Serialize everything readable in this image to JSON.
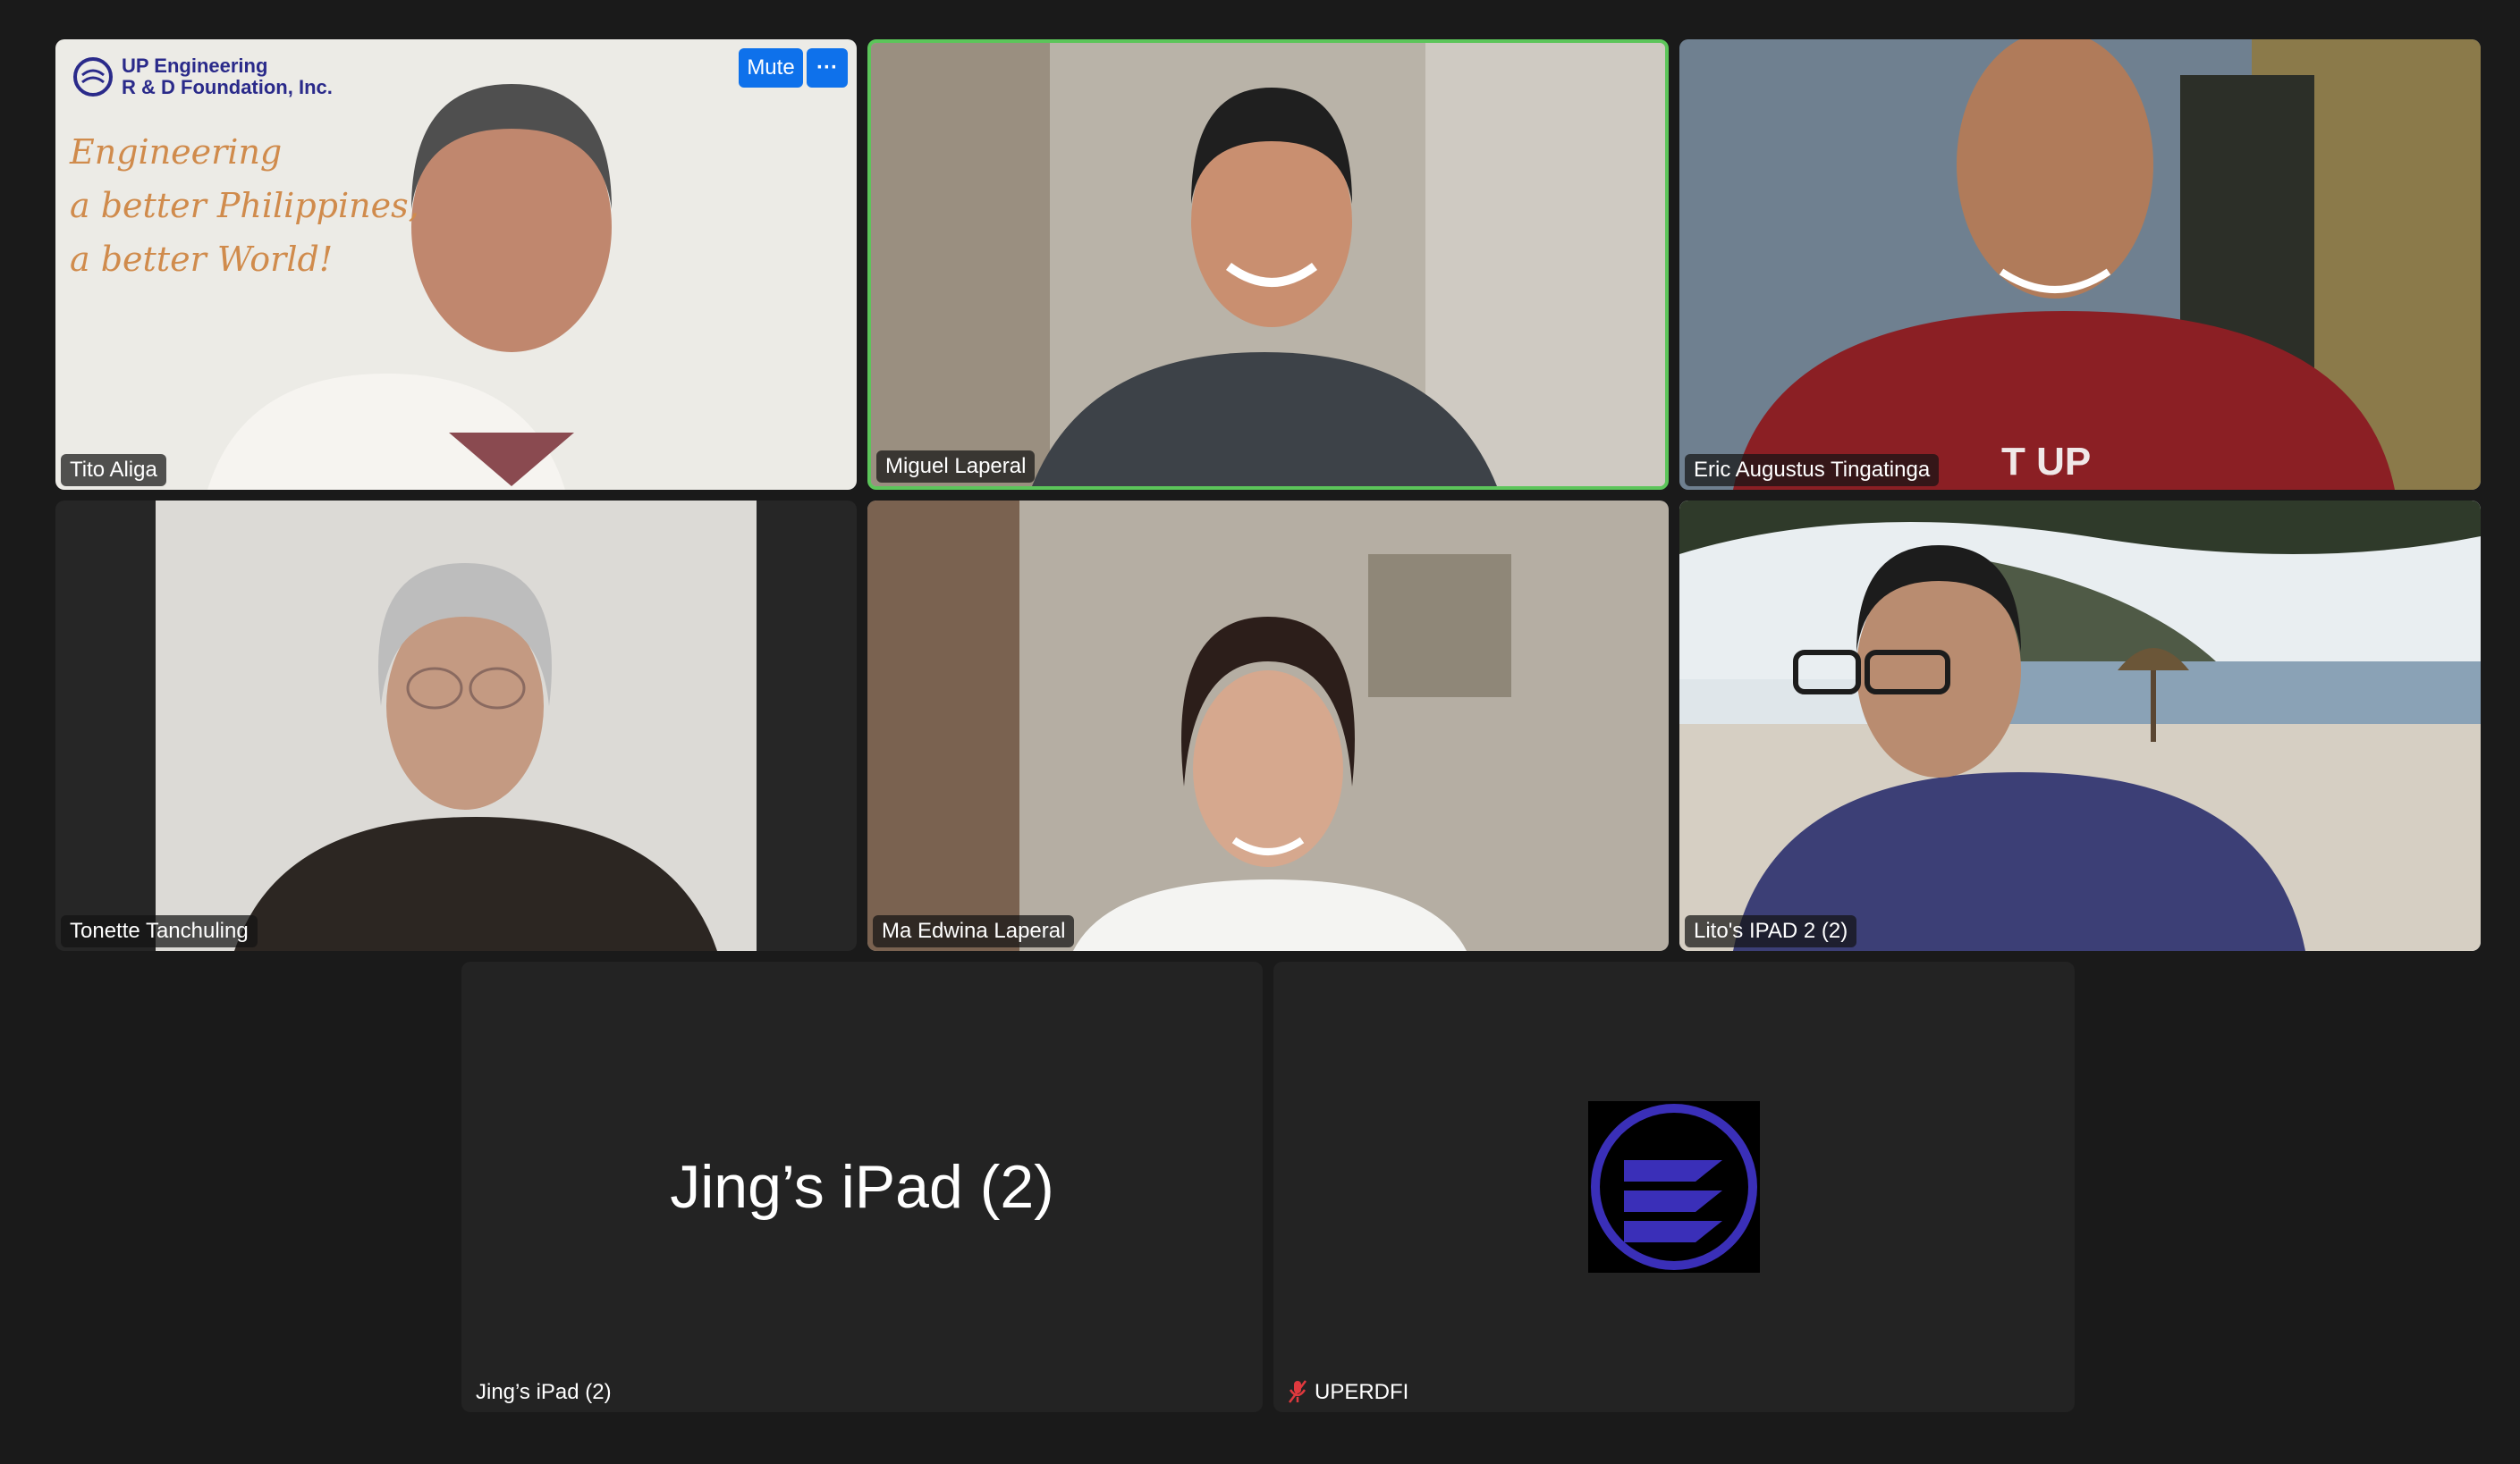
{
  "participants": [
    {
      "name": "Tito Aliga"
    },
    {
      "name": "Miguel Laperal"
    },
    {
      "name": "Eric Augustus Tingatinga"
    },
    {
      "name": "Tonette Tanchuling"
    },
    {
      "name": "Ma Edwina Laperal"
    },
    {
      "name": "Lito's IPAD 2 (2)"
    },
    {
      "name": "Jing’s iPad (2)",
      "display_name": "Jing’s iPad (2)"
    },
    {
      "name": "UPERDFI"
    }
  ],
  "tile_controls": {
    "mute_label": "Mute",
    "more_label": "···"
  },
  "backgrounds": {
    "tito_line1": "UP Engineering",
    "tito_line2": "R & D Foundation, Inc.",
    "tito_slogan1": "Engineering",
    "tito_slogan2": "a better Philippines,",
    "tito_slogan3": "a better World!",
    "eric_shirt_text": "T UP"
  },
  "colors": {
    "active_speaker_border": "#5cc55a",
    "mute_button": "#0e71eb",
    "tile_bg": "#232323",
    "page_bg": "#1a1a1a",
    "logo_blue": "#3a2fb8",
    "muted_red": "#e0393e"
  },
  "icons": {
    "muted": "microphone-muted-icon",
    "more": "more-options-icon",
    "logo": "uperdfi-logo-icon"
  }
}
